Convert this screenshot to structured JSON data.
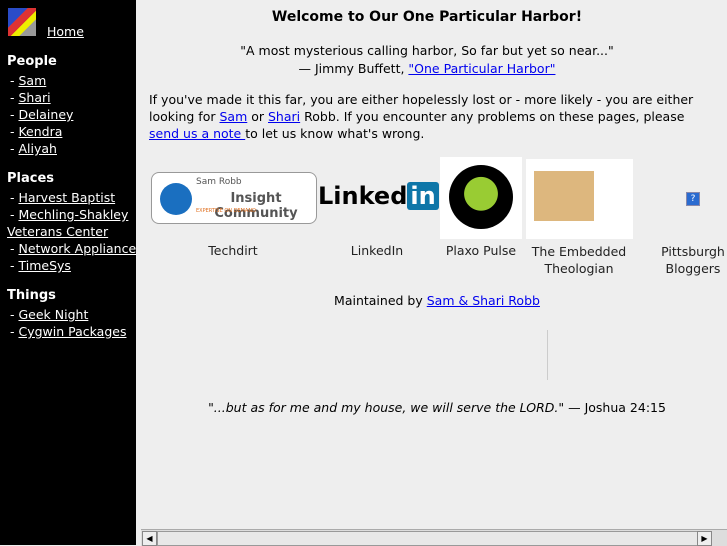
{
  "sidebar": {
    "home": "Home",
    "sections": [
      {
        "title": "People",
        "items": [
          "Sam",
          "Shari",
          "Delainey",
          "Kendra",
          "Aliyah"
        ]
      },
      {
        "title": "Places",
        "items": [
          "Harvest Baptist",
          "Mechling-Shakley",
          "Network Appliance",
          "TimeSys"
        ],
        "continuation": "Veterans Center"
      },
      {
        "title": "Things",
        "items": [
          "Geek Night",
          "Cygwin Packages"
        ]
      }
    ]
  },
  "main": {
    "title": "Welcome to Our One Particular Harbor!",
    "quote": "\"A most mysterious calling harbor, So far but yet so near...\"",
    "quote_attrib": "— Jimmy Buffett, ",
    "quote_link": "\"One Particular Harbor\"",
    "intro1": "If you've made it this far, you are either hopelessly lost or - more likely - you are either looking for ",
    "sam": "Sam",
    "or": " or ",
    "shari": "Shari",
    "intro2": " Robb. If you encounter any problems on these pages, please ",
    "note_link": "send us a note ",
    "intro3": "to let us know what's wrong.",
    "cards": [
      {
        "label": "Techdirt",
        "logo_top": "Sam Robb",
        "logo_main": "Insight Community",
        "logo_sub": "EXPERTISE ON DEMAND"
      },
      {
        "label": "LinkedIn",
        "logo": "Linked",
        "logo_in": "in"
      },
      {
        "label": "Plaxo Pulse"
      },
      {
        "label": "The Embedded Theologian"
      },
      {
        "label": "Pittsburgh Bloggers",
        "logo": "?"
      }
    ],
    "maintained": "Maintained by ",
    "maintainers": "Sam & Shari Robb",
    "verse": "\"...but as for me and my house, we will serve the LORD.\"",
    "verse_ref": " — Joshua 24:15"
  }
}
